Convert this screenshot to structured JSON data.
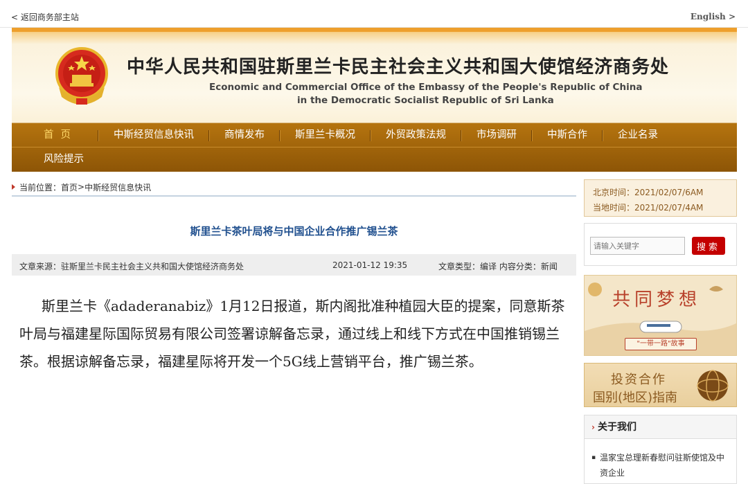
{
  "topbar": {
    "back_label": "< 返回商务部主站",
    "english_label": "English >"
  },
  "header": {
    "title_cn": "中华人民共和国驻斯里兰卡民主社会主义共和国大使馆经济商务处",
    "title_en_line1": "Economic and Commercial Office of the Embassy of the People's Republic of China",
    "title_en_line2": "in the Democratic Socialist Republic of Sri Lanka"
  },
  "nav": {
    "row1": [
      "首页",
      "中斯经贸信息快讯",
      "商情发布",
      "斯里兰卡概况",
      "外贸政策法规",
      "市场调研",
      "中斯合作",
      "企业名录"
    ],
    "row2": [
      "风险提示"
    ]
  },
  "breadcrumb": {
    "label": "当前位置：",
    "home": "首页",
    "sep": "> ",
    "current": "中斯经贸信息快讯"
  },
  "article": {
    "title": "斯里兰卡茶叶局将与中国企业合作推广锡兰茶",
    "source": "文章来源：驻斯里兰卡民主社会主义共和国大使馆经济商务处",
    "datetime": "2021-01-12 19:35",
    "type": "文章类型：编译 内容分类：新闻",
    "body": "斯里兰卡《adaderanabiz》1月12日报道，斯内阁批准种植园大臣的提案，同意斯茶叶局与福建星际国际贸易有限公司签署谅解备忘录，通过线上和线下方式在中国推销锡兰茶。根据谅解备忘录，福建星际将开发一个5G线上营销平台，推广锡兰茶。"
  },
  "sidebar": {
    "beijing_time": "北京时间：2021/02/07/6AM",
    "local_time": "当地时间：2021/02/07/4AM",
    "search_placeholder": "请输入关键字",
    "search_button": "搜索",
    "promo1_title": "共同梦想",
    "promo1_sub": "\"一带一路\"故事",
    "promo2_line1": "投资合作",
    "promo2_line2": "国别(地区)指南",
    "about_title": "关于我们",
    "about_item": "温家宝总理新春慰问驻斯使馆及中资企业"
  },
  "colors": {
    "nav_bg": "#a0650b",
    "accent_red": "#c40000",
    "title_blue": "#1f4f8e"
  }
}
